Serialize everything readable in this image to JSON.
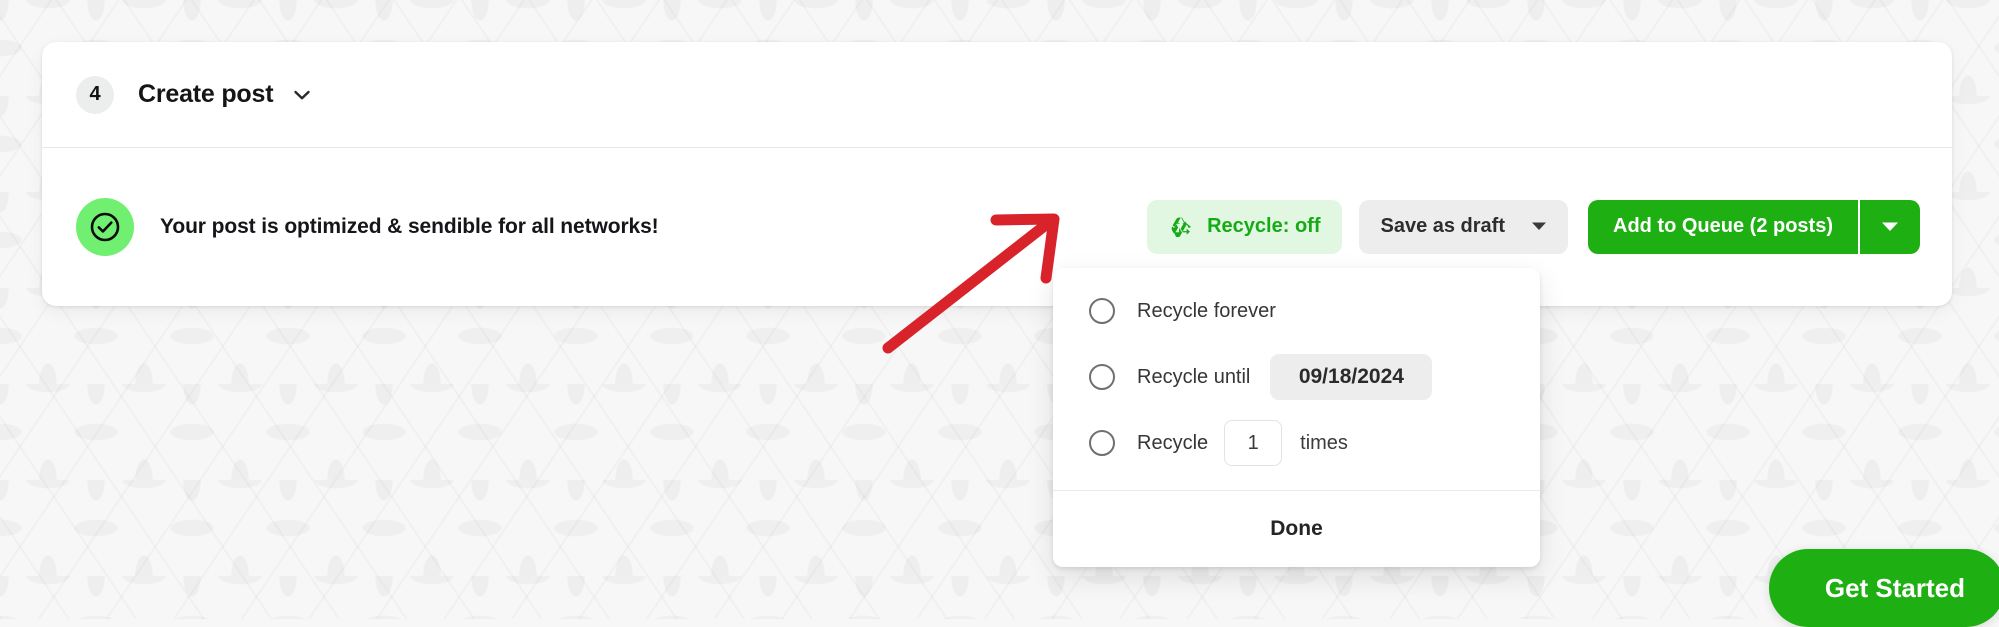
{
  "card": {
    "step_number": "4",
    "title": "Create post",
    "collapse_icon": "chevron-down-icon",
    "status": {
      "icon": "check-circle-icon",
      "message": "Your post is optimized & sendible for all networks!",
      "accent_color": "#70ef70"
    },
    "actions": {
      "recycle": {
        "icon": "recycle-icon",
        "label": "Recycle: off",
        "text_color": "#16ab16",
        "background_color": "#e2f7e2"
      },
      "save_draft": {
        "label": "Save as draft",
        "caret_icon": "caret-down-icon",
        "background_color": "#ededed"
      },
      "add_to_queue": {
        "label": "Add to Queue (2 posts)",
        "caret_icon": "caret-down-icon",
        "background_color": "#1eaf13"
      }
    }
  },
  "recycle_dropdown": {
    "options": [
      {
        "radio_icon": "radio-unchecked-icon",
        "label": "Recycle forever",
        "selected": false
      },
      {
        "radio_icon": "radio-unchecked-icon",
        "label": "Recycle until",
        "selected": false,
        "date_value": "09/18/2024"
      },
      {
        "radio_icon": "radio-unchecked-icon",
        "label": "Recycle",
        "selected": false,
        "times_value": "1",
        "suffix": "times"
      }
    ],
    "done_label": "Done"
  },
  "annotation": {
    "type": "arrow",
    "color": "#d8232a",
    "points_to": "recycle-button"
  },
  "floating_cta": {
    "label": "Get Started",
    "background_color": "#1eaf13"
  }
}
